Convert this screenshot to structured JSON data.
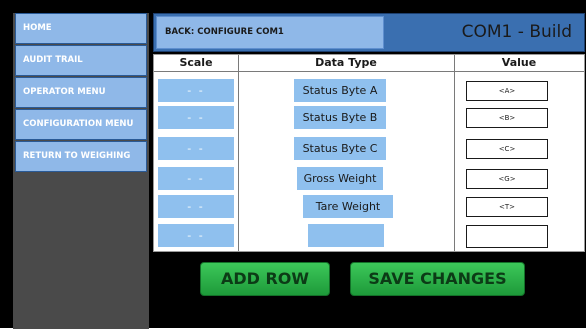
{
  "sidebar": {
    "items": [
      {
        "label": "HOME"
      },
      {
        "label": "AUDIT TRAIL"
      },
      {
        "label": "OPERATOR MENU"
      },
      {
        "label": "CONFIGURATION MENU"
      },
      {
        "label": "RETURN TO WEIGHING"
      }
    ]
  },
  "header": {
    "back_label": "BACK: CONFIGURE COM1",
    "title": "COM1 - Build"
  },
  "table": {
    "columns": [
      "Scale",
      "Data Type",
      "Value"
    ],
    "rows": [
      {
        "scale": "- -",
        "data_type": "Status Byte A",
        "value": "<A>"
      },
      {
        "scale": "- -",
        "data_type": "Status Byte B",
        "value": "<B>"
      },
      {
        "scale": "- -",
        "data_type": "Status Byte C",
        "value": "<C>"
      },
      {
        "scale": "- -",
        "data_type": "Gross Weight",
        "value": "<G>"
      },
      {
        "scale": "- -",
        "data_type": "Tare Weight",
        "value": "<T>"
      },
      {
        "scale": "- -",
        "data_type": "",
        "value": ""
      }
    ]
  },
  "actions": {
    "add_row_label": "ADD ROW",
    "save_label": "SAVE CHANGES"
  },
  "colors": {
    "background": "#000000",
    "sidebar_bg": "#4a4a4a",
    "nav_button": "#8fb8e8",
    "header_bar": "#3a6fb0",
    "cell_blue": "#8fc0ee",
    "action_green": "#2eb84a"
  }
}
